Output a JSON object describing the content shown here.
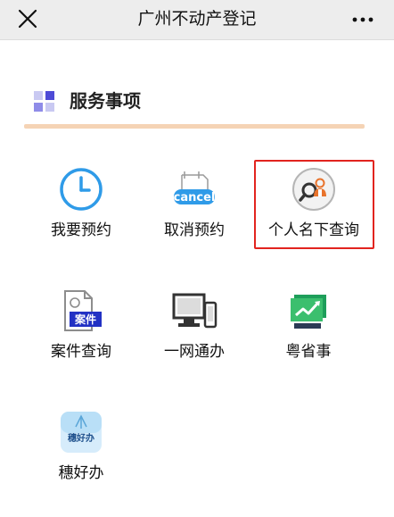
{
  "header": {
    "title": "广州不动产登记"
  },
  "section": {
    "title": "服务事项"
  },
  "services": [
    {
      "label": "我要预约",
      "icon": "clock-icon"
    },
    {
      "label": "取消预约",
      "icon": "cancel-icon",
      "icon_text": "cancel"
    },
    {
      "label": "个人名下查询",
      "icon": "person-search-icon"
    },
    {
      "label": "案件查询",
      "icon": "case-document-icon",
      "icon_text": "案件"
    },
    {
      "label": "一网通办",
      "icon": "computer-icon"
    },
    {
      "label": "粤省事",
      "icon": "yue-sheng-shi-icon"
    },
    {
      "label": "穗好办",
      "icon": "sui-hao-ban-icon",
      "icon_text": "穗好办"
    }
  ],
  "colors": {
    "accent_blue": "#2f9be8",
    "highlight_red": "#e2241f",
    "underline_peach": "#f5d3b5",
    "topbar_bg": "#ededed"
  }
}
